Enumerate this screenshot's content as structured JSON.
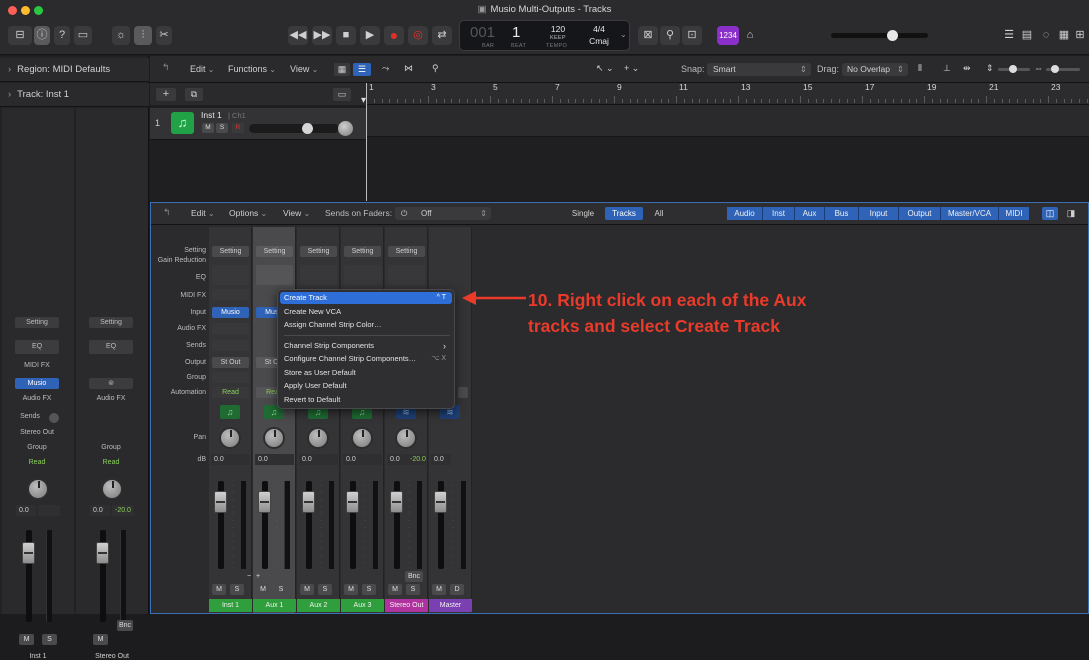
{
  "window": {
    "title": "Musio Multi-Outputs - Tracks"
  },
  "lcd": {
    "bar": "001",
    "beat_big": "1",
    "bar_label": "BAR",
    "beat_label": "BEAT",
    "tempo": "120",
    "tempo_mode": "KEEP",
    "tempo_label": "TEMPO",
    "signature": "4/4",
    "key": "Cmaj"
  },
  "toolbar": {
    "count_in": "1234"
  },
  "inspector": {
    "region_label": "Region:",
    "region_value": "MIDI Defaults",
    "track_label": "Track:",
    "track_value": "Inst 1"
  },
  "inspector_strips": [
    {
      "setting": "Setting",
      "eq": "EQ",
      "midi_fx": "MIDI FX",
      "instrument": "Musio",
      "audio_fx": "Audio FX",
      "sends": "Sends",
      "output": "Stereo Out",
      "group": "Group",
      "automation": "Read",
      "pan_value": "0.0",
      "peak": "",
      "mute": "M",
      "solo": "S",
      "name": "Inst 1"
    },
    {
      "setting": "Setting",
      "eq": "EQ",
      "link": "⊚",
      "audio_fx": "Audio FX",
      "group": "Group",
      "automation": "Read",
      "pan_value": "0.0",
      "peak": "-20.0",
      "mute": "M",
      "bounce": "Bnc",
      "name": "Stereo Out"
    }
  ],
  "tracks_toolbar": {
    "edit": "Edit",
    "functions": "Functions",
    "view": "View",
    "snap_label": "Snap:",
    "snap_value": "Smart",
    "drag_label": "Drag:",
    "drag_value": "No Overlap"
  },
  "ruler": {
    "bars": [
      "1",
      "3",
      "5",
      "7",
      "9",
      "11",
      "13",
      "15",
      "17",
      "19",
      "21",
      "23"
    ]
  },
  "track": {
    "number": "1",
    "name": "Inst 1",
    "channel": "Ch1",
    "mute": "M",
    "solo": "S",
    "record": "R"
  },
  "mixer_toolbar": {
    "edit": "Edit",
    "options": "Options",
    "view": "View",
    "sends_on_faders": "Sends on Faders:",
    "sends_value": "Off",
    "view_modes": [
      "Single",
      "Tracks",
      "All"
    ],
    "active_mode": "Tracks",
    "filters": [
      "Audio",
      "Inst",
      "Aux",
      "Bus",
      "Input",
      "Output",
      "Master/VCA",
      "MIDI"
    ]
  },
  "mixer_row_labels": [
    "Setting",
    "Gain Reduction",
    "EQ",
    "MIDI FX",
    "Input",
    "Audio FX",
    "Sends",
    "Output",
    "Group",
    "Automation",
    "Pan",
    "dB"
  ],
  "mixer_strips": [
    {
      "setting": "Setting",
      "input": "Musio",
      "output": "St Out",
      "automation": "Read",
      "pan_value": "0.0",
      "peak": "",
      "name": "Inst 1",
      "color": "#2f9e3c"
    },
    {
      "setting": "Setting",
      "input": "Musio",
      "output": "St Out",
      "automation": "Read",
      "pan_value": "0.0",
      "peak": "",
      "name": "Aux 1",
      "color": "#2f9e3c"
    },
    {
      "setting": "Setting",
      "pan_value": "0.0",
      "peak": "",
      "name": "Aux 2",
      "color": "#2f9e3c"
    },
    {
      "setting": "Setting",
      "pan_value": "0.0",
      "peak": "",
      "name": "Aux 3",
      "color": "#2f9e3c"
    },
    {
      "setting": "Setting",
      "pan_value": "0.0",
      "peak": "-20.0",
      "name": "Stereo Out",
      "color": "#b0329e"
    },
    {
      "pan_value": "0.0",
      "name": "Master",
      "color": "#7a3fb0"
    }
  ],
  "strip_buttons": {
    "mute": "M",
    "solo": "S",
    "dim": "D",
    "bounce": "Bnc"
  },
  "context_menu": {
    "items": [
      {
        "label": "Create Track",
        "shortcut": "^ T"
      },
      {
        "label": "Create New VCA",
        "shortcut": ""
      },
      {
        "label": "Assign Channel Strip Color…",
        "shortcut": ""
      },
      {
        "label": "Channel Strip Components",
        "shortcut": "›"
      },
      {
        "label": "Configure Channel Strip Components…",
        "shortcut": "⌥ X"
      },
      {
        "label": "Store as User Default",
        "shortcut": ""
      },
      {
        "label": "Apply User Default",
        "shortcut": ""
      },
      {
        "label": "Revert to Default",
        "shortcut": ""
      }
    ]
  },
  "annotation": {
    "line1": "10. Right click on each of the Aux",
    "line2": "tracks and select Create Track"
  },
  "colors": {
    "accent": "#2e63b8",
    "annotation": "#ea3a2a",
    "green_track": "#2f9e3c",
    "record": "#e0302a"
  }
}
